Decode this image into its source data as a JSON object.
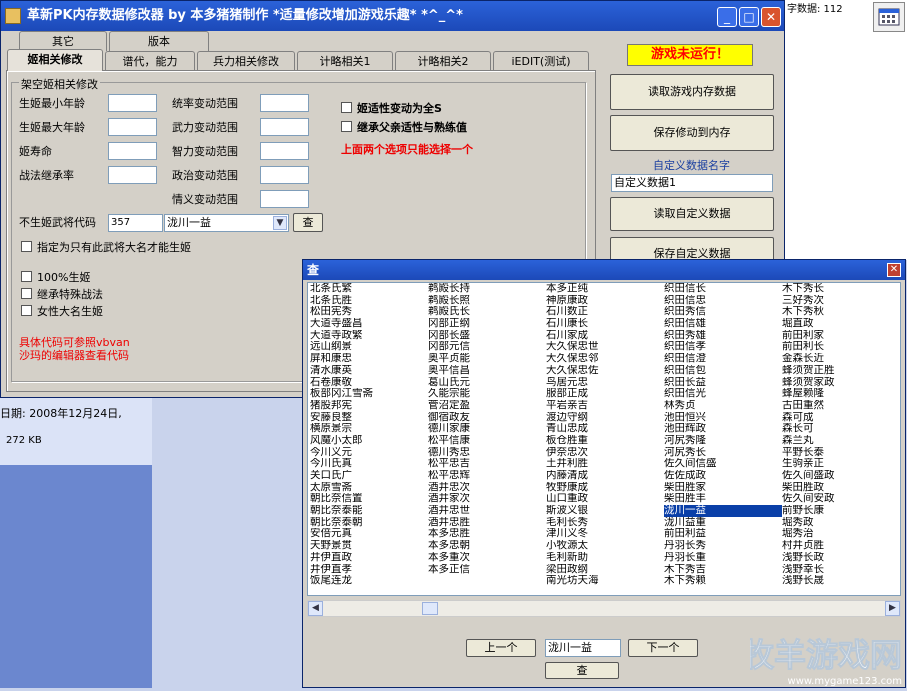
{
  "main_window": {
    "title": "革新PK内存数据修改器  by 本多猪猪制作  *适量修改增加游戏乐趣*      *^_^*",
    "controls": {
      "minimize": "_",
      "maximize": "□",
      "close": "✕"
    }
  },
  "tabs_row1": [
    "其它",
    "版本"
  ],
  "tabs_row2": [
    "姬相关修改",
    "谱代，能力",
    "兵力相关修改",
    "计略相关1",
    "计略相关2",
    "iEDIT(测试)"
  ],
  "active_tab": "姬相关修改",
  "group_title": "架空姬相关修改",
  "fields_left": [
    "生姬最小年龄",
    "生姬最大年龄",
    "姬寿命",
    "战法继承率"
  ],
  "fields_mid": [
    "统率变动范围",
    "武力变动范围",
    "智力变动范围",
    "政治变动范围",
    "情义变动范围"
  ],
  "options": {
    "opt1": "姬适性变动为全S",
    "opt2": "继承父亲适性与熟练值",
    "warning": "上面两个选项只能选择一个"
  },
  "no_princess": {
    "label": "不生姬武将代码",
    "code": "357",
    "name": "泷川一益",
    "search_btn": "查"
  },
  "checks": [
    "指定为只有此武将大名才能生姬",
    "100%生姬",
    "继承特殊战法",
    "女性大名生姬"
  ],
  "note_lines": [
    "具体代码可参照vbvan",
    "沙玛的编辑器查看代码"
  ],
  "right_panel": {
    "status": "游戏未运行！",
    "btn_read": "读取游戏内存数据",
    "btn_save": "保存修动到内存",
    "custom_label": "自定义数据名字",
    "custom_value": "自定义数据1",
    "btn_read_custom": "读取自定义数据",
    "btn_save_custom": "保存自定义数据"
  },
  "left_info": {
    "date": "日期: 2008年12月24日,",
    "size": "272 KB"
  },
  "topright_text": "字数据: 112",
  "dialog": {
    "title": "查",
    "close": "✕",
    "prev": "上一个",
    "next": "下一个",
    "search_value": "泷川一益",
    "search_btn": "查",
    "selected": "泷川一益",
    "columns": [
      [
        "北条氏繁",
        "北条氏胜",
        "松田宪秀",
        "大道寺盛昌",
        "大道寺政繁",
        "远山纲景",
        "屏和康忠",
        "清水康英",
        "石卷康敬",
        "板部冈江雪斋",
        "猪股邦宪",
        "安藤良整",
        "横原景宗",
        "风魔小太郎",
        "今川义元",
        "今川氏真",
        "关口氏广",
        "太原雪斋",
        "朝比奈信置",
        "朝比奈泰能",
        "朝比奈泰朝",
        "安倍元真",
        "天野景贯",
        "井伊直政",
        "井伊直孝",
        "饭尾连龙"
      ],
      [
        "鹈殿长持",
        "鹈殿长照",
        "鹈殿氏长",
        "冈部正纲",
        "冈部长盛",
        "冈部元信",
        "奥平贞能",
        "奥平信昌",
        "葛山氏元",
        "久能宗能",
        "菅沼定盈",
        "御宿政友",
        "德川家康",
        "松平信康",
        "德川秀忠",
        "松平忠吉",
        "松平忠辉",
        "酒井忠次",
        "酒井家次",
        "酒井忠世",
        "酒井忠胜",
        "本多忠胜",
        "本多忠朝",
        "本多重次",
        "本多正信"
      ],
      [
        "本多正纯",
        "神原康政",
        "石川数正",
        "石川康长",
        "石川家成",
        "大久保忠世",
        "大久保忠邻",
        "大久保忠佐",
        "鸟居元忠",
        "服部正成",
        "平岩亲吉",
        "渡边守纲",
        "青山忠成",
        "板仓胜重",
        "伊奈忠次",
        "土井利胜",
        "内藤清成",
        "牧野康成",
        "山口重政",
        "斯波义银",
        "毛利长秀",
        "津川义冬",
        "小牧源太",
        "毛利新助",
        "梁田政纲",
        "南光坊天海"
      ],
      [
        "织田信长",
        "织田信忠",
        "织田秀信",
        "织田信雄",
        "织田秀雄",
        "织田信孝",
        "织田信澄",
        "织田信包",
        "织田长益",
        "织田信光",
        "林秀贞",
        "池田恒兴",
        "池田辉政",
        "河尻秀隆",
        "河尻秀长",
        "佐久间信盛",
        "佐佐成政",
        "柴田胜家",
        "柴田胜丰",
        "泷川一益",
        "泷川益重",
        "前田利益",
        "丹羽长秀",
        "丹羽长重",
        "木下秀吉",
        "木下秀赖"
      ],
      [
        "木下秀长",
        "三好秀次",
        "木下秀秋",
        "堀直政",
        "前田利家",
        "前田利长",
        "金森长近",
        "蜂须贺正胜",
        "蜂须贺家政",
        "蜂屋赖隆",
        "古田重然",
        "森可成",
        "森长可",
        "森兰丸",
        "平野长泰",
        "生驹亲正",
        "佐久间盛政",
        "柴田胜政",
        "佐久间安政",
        "前野长康",
        "堀秀政",
        "堀秀治",
        "村井贞胜",
        "浅野长政",
        "浅野幸长",
        "浅野长晟"
      ]
    ]
  }
}
